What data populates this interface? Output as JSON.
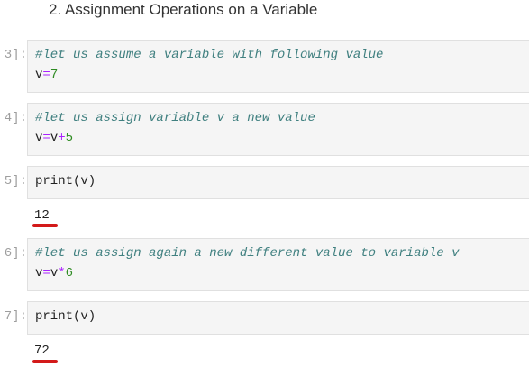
{
  "heading": "2. Assignment Operations on a Variable",
  "cells": [
    {
      "prompt": "3]:",
      "line1": {
        "comment": "#let us assume a variable with following value"
      },
      "line2": {
        "name": "v",
        "op": "=",
        "num": "7"
      }
    },
    {
      "prompt": "4]:",
      "line1": {
        "comment": "#let us assign variable v a new value"
      },
      "line2": {
        "name1": "v",
        "op1": "=",
        "name2": "v",
        "op2": "+",
        "num": "5"
      }
    },
    {
      "prompt": "5]:",
      "code": "print(v)",
      "output": "12"
    },
    {
      "prompt": "6]:",
      "line1": {
        "comment": "#let us assign again a new different value to variable v"
      },
      "line2": {
        "name1": "v",
        "op1": "=",
        "name2": "v",
        "op2": "*",
        "num": "6"
      }
    },
    {
      "prompt": "7]:",
      "code": "print(v)",
      "output": "72"
    }
  ],
  "colors": {
    "comment": "#408080",
    "operator": "#aa22ff",
    "number": "#2e8b22",
    "underline": "#d31a1a"
  }
}
